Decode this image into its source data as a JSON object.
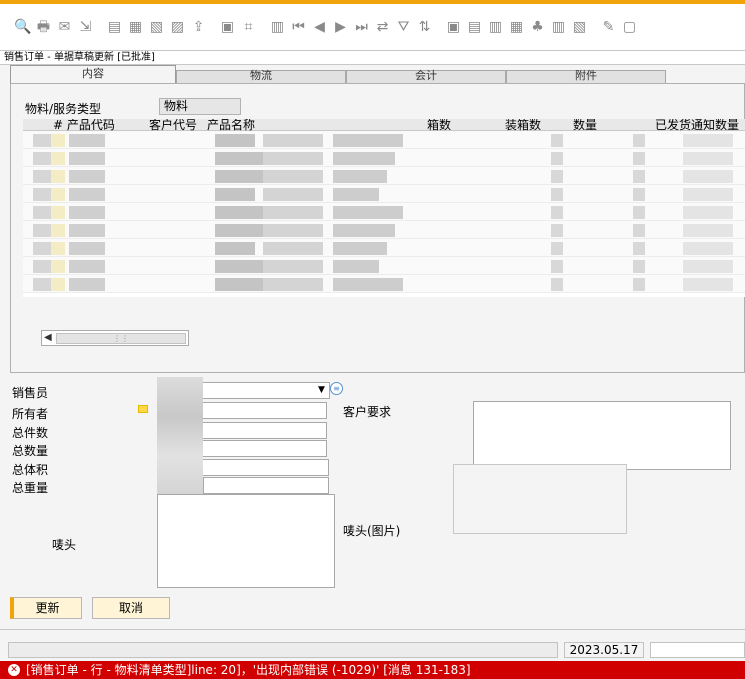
{
  "toolbar": {
    "icons": [
      "print-preview-icon",
      "print-icon",
      "email-icon",
      "send-icon",
      "save-icon",
      "export-excel-icon",
      "export-word-icon",
      "export-pdf-icon",
      "launch-icon",
      "lock-icon",
      "find-icon",
      "add-icon",
      "first-record-icon",
      "previous-record-icon",
      "next-record-icon",
      "last-record-icon",
      "refresh-icon",
      "filter-icon",
      "sort-icon",
      "base-document-icon",
      "target-document-icon",
      "copy-to-icon",
      "copy-from-icon",
      "gross-profit-icon",
      "payment-icon",
      "settings-icon",
      "edit-icon",
      "layout-icon"
    ]
  },
  "window": {
    "title": "销售订单 - 单据草稿更新 [已批准]"
  },
  "tabs": [
    {
      "label": "内容",
      "active": true
    },
    {
      "label": "物流",
      "active": false
    },
    {
      "label": "会计",
      "active": false
    },
    {
      "label": "附件",
      "active": false
    }
  ],
  "content": {
    "item_type_label": "物料/服务类型",
    "item_type_value": "物料"
  },
  "grid": {
    "columns": [
      "# 产品代码",
      "客户代号",
      "产品名称",
      "箱数",
      "装箱数",
      "数量",
      "已发货通知数量"
    ]
  },
  "form": {
    "sales_employee_label": "销售员",
    "owner_label": "所有者",
    "total_pieces_label": "总件数",
    "total_qty_label": "总数量",
    "total_volume_label": "总体积",
    "total_weight_label": "总重量",
    "customer_req_label": "客户要求",
    "shipping_mark_label": "唛头",
    "shipping_mark_image_label": "唛头(图片)"
  },
  "buttons": {
    "update": "更新",
    "cancel": "取消"
  },
  "status": {
    "date": "2023.05.17"
  },
  "error": {
    "message": "[销售订单 - 行 - 物料清单类型]line: 20]，'出现内部错误 (-1029)' [消息 131-183]"
  },
  "colors": {
    "accent": "#f0a30a",
    "error": "#d00000"
  }
}
